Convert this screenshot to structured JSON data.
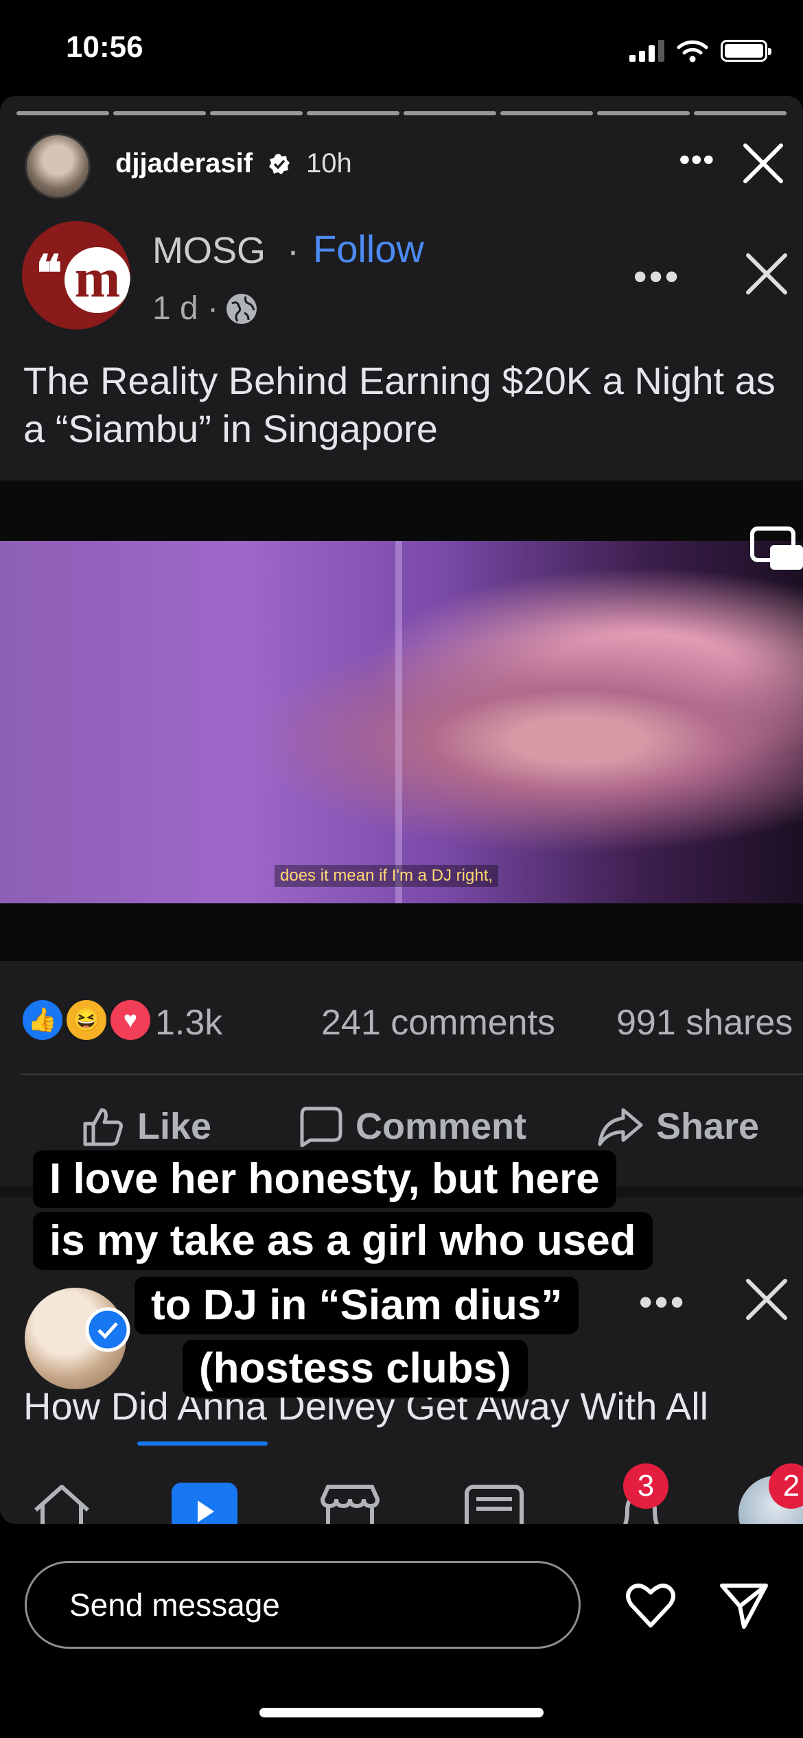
{
  "status_bar": {
    "time": "10:56"
  },
  "story": {
    "username": "djjaderasif",
    "time_ago": "10h",
    "more_label": "•••"
  },
  "post": {
    "page_name": "MOSG",
    "dot": "·",
    "follow_label": "Follow",
    "meta": "1 d ·",
    "more_label": "•••",
    "title": "The Reality Behind Earning $20K a Night as a “Siambu” in Singapore",
    "video_caption": "does it mean if I'm a DJ right,",
    "reactions_count": "1.3k",
    "comments_count": "241 comments",
    "shares_count": "991 shares",
    "actions": {
      "like": "Like",
      "comment": "Comment",
      "share": "Share"
    }
  },
  "next_post": {
    "more_label": "•••",
    "title": "How Did Anna Delvey Get Away With All"
  },
  "fb_tabbar": {
    "notifications_badge": "3",
    "profile_badge": "2"
  },
  "overlay_text": [
    "I love her honesty, but here",
    "is my take as a girl who used",
    "to DJ in “Siam dius”",
    "(hostess clubs)"
  ],
  "reply": {
    "placeholder": "Send message"
  }
}
